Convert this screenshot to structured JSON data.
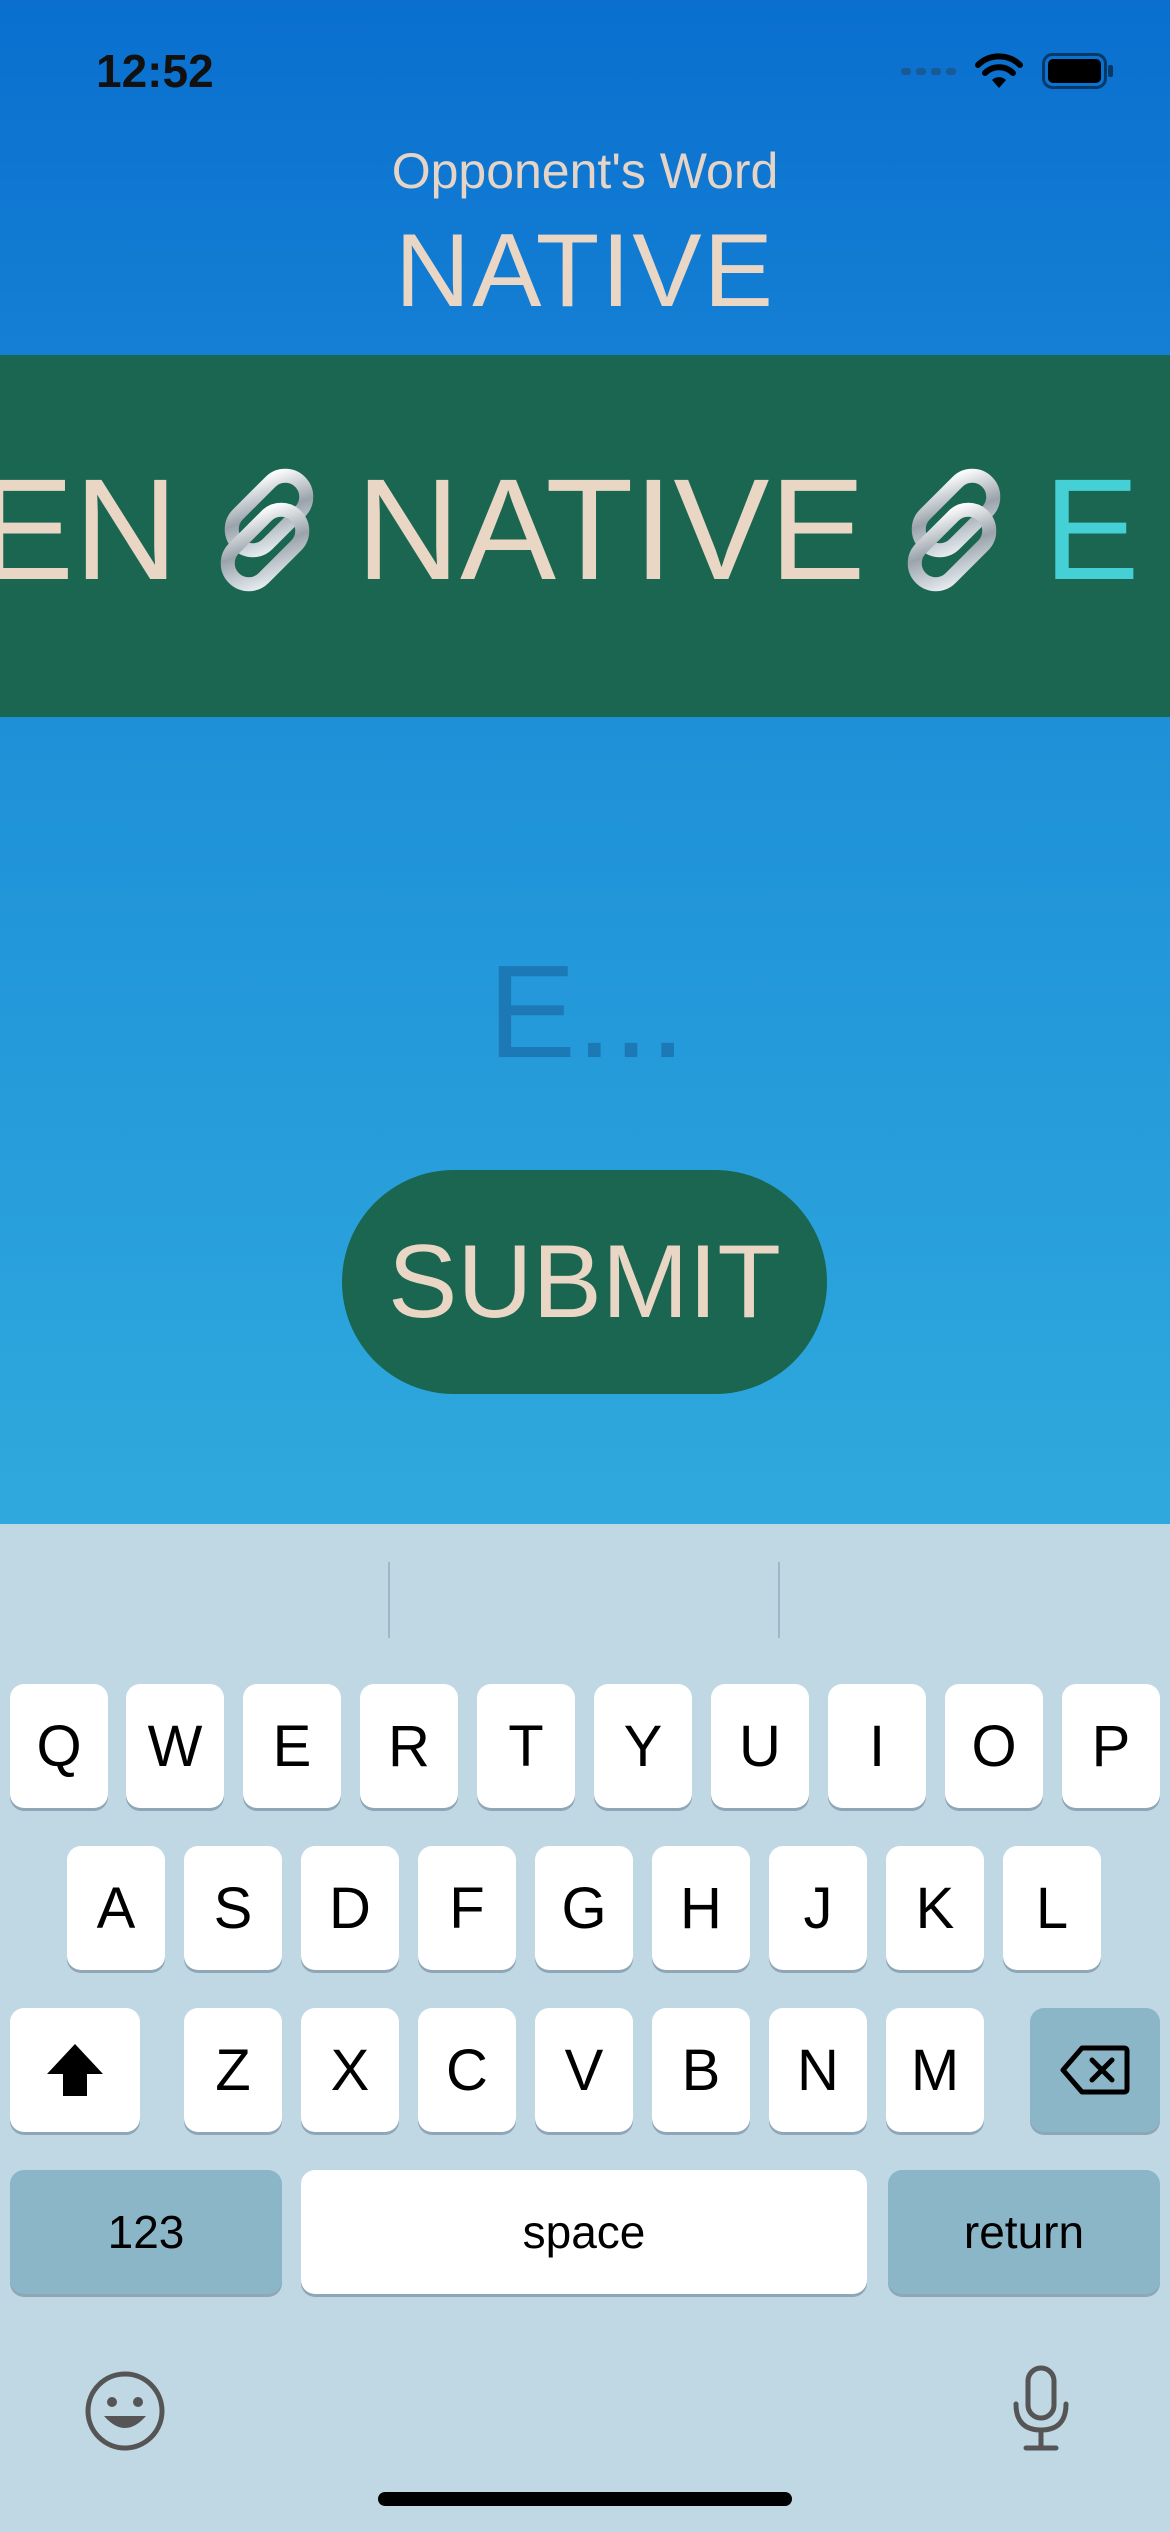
{
  "status": {
    "time": "12:52"
  },
  "header": {
    "label": "Opponent's Word",
    "word": "NATIVE"
  },
  "chain": {
    "prev_fragment": "EN",
    "current_word": "NATIVE",
    "next_letter": "E",
    "link_icon": "link-icon"
  },
  "input": {
    "value": "",
    "placeholder": "E..."
  },
  "submit": {
    "label": "SUBMIT"
  },
  "keyboard": {
    "row1": [
      "Q",
      "W",
      "E",
      "R",
      "T",
      "Y",
      "U",
      "I",
      "O",
      "P"
    ],
    "row2": [
      "A",
      "S",
      "D",
      "F",
      "G",
      "H",
      "J",
      "K",
      "L"
    ],
    "row3": [
      "Z",
      "X",
      "C",
      "V",
      "B",
      "N",
      "M"
    ],
    "numbers_label": "123",
    "space_label": "space",
    "return_label": "return",
    "shift_icon": "shift-icon",
    "delete_icon": "delete-icon",
    "emoji_icon": "emoji-icon",
    "mic_icon": "microphone-icon"
  },
  "colors": {
    "band": "#1a6650",
    "text_cream": "#e9d6c4",
    "accent_cyan": "#45d0d6"
  }
}
